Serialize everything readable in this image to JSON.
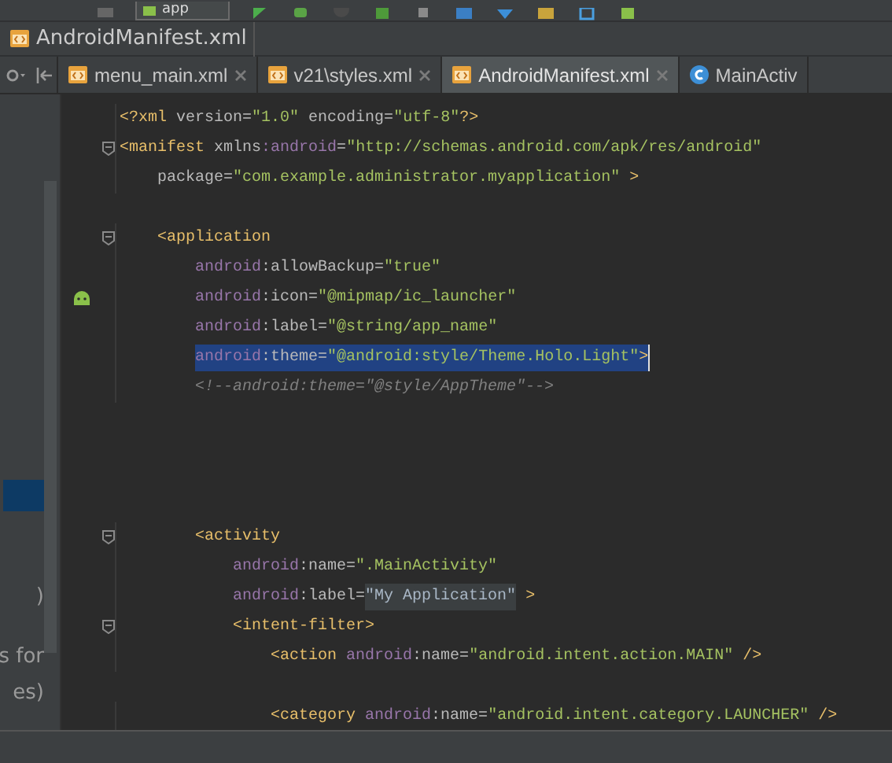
{
  "toolbar": {
    "run_config": "app"
  },
  "breadcrumb": {
    "file": "AndroidManifest.xml"
  },
  "tabs": [
    {
      "label": "menu_main.xml",
      "kind": "xml",
      "selected": false,
      "closable": true
    },
    {
      "label": "v21\\styles.xml",
      "kind": "xml",
      "selected": false,
      "closable": true
    },
    {
      "label": "AndroidManifest.xml",
      "kind": "xml",
      "selected": true,
      "closable": true
    },
    {
      "label": "MainActiv",
      "kind": "class",
      "selected": false,
      "closable": false
    }
  ],
  "sidebar": {
    "fragments": [
      {
        "text": ")"
      },
      {
        "text": "s for"
      },
      {
        "text": "es)"
      }
    ]
  },
  "editor": {
    "lines": [
      {
        "kind": "code",
        "fold": false,
        "gutter_icon": false,
        "selected": false,
        "tokens": [
          {
            "kind": "tag",
            "text": "<?xml"
          },
          {
            "kind": "attr",
            "text": " version="
          },
          {
            "kind": "value",
            "text": "\"1.0\""
          },
          {
            "kind": "attr",
            "text": " encoding="
          },
          {
            "kind": "value",
            "text": "\"utf-8\""
          },
          {
            "kind": "tag",
            "text": "?>"
          }
        ]
      },
      {
        "kind": "code",
        "fold": true,
        "gutter_icon": false,
        "selected": false,
        "tokens": [
          {
            "kind": "tag",
            "text": "<manifest"
          },
          {
            "kind": "attr",
            "text": " xmlns"
          },
          {
            "kind": "ns",
            "text": ":android"
          },
          {
            "kind": "attr",
            "text": "="
          },
          {
            "kind": "value",
            "text": "\"http://schemas.android.com/apk/res/android\""
          }
        ]
      },
      {
        "kind": "code",
        "fold": false,
        "gutter_icon": false,
        "selected": false,
        "tokens": [
          {
            "kind": "attr",
            "text": "    package="
          },
          {
            "kind": "value",
            "text": "\"com.example.administrator.myapplication\""
          },
          {
            "kind": "tag",
            "text": " >"
          }
        ]
      },
      {
        "kind": "blank"
      },
      {
        "kind": "code",
        "fold": true,
        "gutter_icon": false,
        "selected": false,
        "tokens": [
          {
            "kind": "tag",
            "text": "    <application"
          }
        ]
      },
      {
        "kind": "code",
        "fold": false,
        "gutter_icon": false,
        "selected": false,
        "tokens": [
          {
            "kind": "ns",
            "text": "        android"
          },
          {
            "kind": "attr",
            "text": ":allowBackup="
          },
          {
            "kind": "value",
            "text": "\"true\""
          }
        ]
      },
      {
        "kind": "code",
        "fold": false,
        "gutter_icon": true,
        "selected": false,
        "tokens": [
          {
            "kind": "ns",
            "text": "        android"
          },
          {
            "kind": "attr",
            "text": ":icon="
          },
          {
            "kind": "value",
            "text": "\"@mipmap/ic_launcher\""
          }
        ]
      },
      {
        "kind": "code",
        "fold": false,
        "gutter_icon": false,
        "selected": false,
        "tokens": [
          {
            "kind": "ns",
            "text": "        android"
          },
          {
            "kind": "attr",
            "text": ":label="
          },
          {
            "kind": "value",
            "text": "\"@string/app_name\""
          }
        ]
      },
      {
        "kind": "code",
        "fold": false,
        "gutter_icon": false,
        "selected": true,
        "tokens": [
          {
            "kind": "ns",
            "text": "        android"
          },
          {
            "kind": "attr",
            "text": ":theme="
          },
          {
            "kind": "value",
            "text": "\"@android:style/Theme.Holo.Light\""
          },
          {
            "kind": "tag",
            "text": ">"
          }
        ]
      },
      {
        "kind": "code",
        "fold": false,
        "gutter_icon": false,
        "selected": false,
        "tokens": [
          {
            "kind": "comment",
            "text": "        <!--android:theme=\"@style/AppTheme\"-->"
          }
        ]
      },
      {
        "kind": "blank"
      },
      {
        "kind": "blank"
      },
      {
        "kind": "blank"
      },
      {
        "kind": "blank"
      },
      {
        "kind": "code",
        "fold": true,
        "gutter_icon": false,
        "selected": false,
        "tokens": [
          {
            "kind": "tag",
            "text": "        <activity"
          }
        ]
      },
      {
        "kind": "code",
        "fold": false,
        "gutter_icon": false,
        "selected": false,
        "tokens": [
          {
            "kind": "ns",
            "text": "            android"
          },
          {
            "kind": "attr",
            "text": ":name="
          },
          {
            "kind": "value",
            "text": "\".MainActivity\""
          }
        ]
      },
      {
        "kind": "code",
        "fold": false,
        "gutter_icon": false,
        "selected": false,
        "tokens": [
          {
            "kind": "ns",
            "text": "            android"
          },
          {
            "kind": "attr",
            "text": ":label="
          },
          {
            "kind": "folded",
            "text": "\"My Application\""
          },
          {
            "kind": "tag",
            "text": " >"
          }
        ]
      },
      {
        "kind": "code",
        "fold": true,
        "gutter_icon": false,
        "selected": false,
        "tokens": [
          {
            "kind": "tag",
            "text": "            <intent-filter>"
          }
        ]
      },
      {
        "kind": "code",
        "fold": false,
        "gutter_icon": false,
        "selected": false,
        "tokens": [
          {
            "kind": "tag",
            "text": "                <action"
          },
          {
            "kind": "ns",
            "text": " android"
          },
          {
            "kind": "attr",
            "text": ":name="
          },
          {
            "kind": "value",
            "text": "\"android.intent.action.MAIN\""
          },
          {
            "kind": "tag",
            "text": " />"
          }
        ]
      },
      {
        "kind": "blank"
      },
      {
        "kind": "code",
        "fold": false,
        "gutter_icon": false,
        "selected": false,
        "tokens": [
          {
            "kind": "tag",
            "text": "                <category"
          },
          {
            "kind": "ns",
            "text": " android"
          },
          {
            "kind": "attr",
            "text": ":name="
          },
          {
            "kind": "value",
            "text": "\"android.intent.category.LAUNCHER\""
          },
          {
            "kind": "tag",
            "text": " />"
          }
        ]
      }
    ]
  }
}
